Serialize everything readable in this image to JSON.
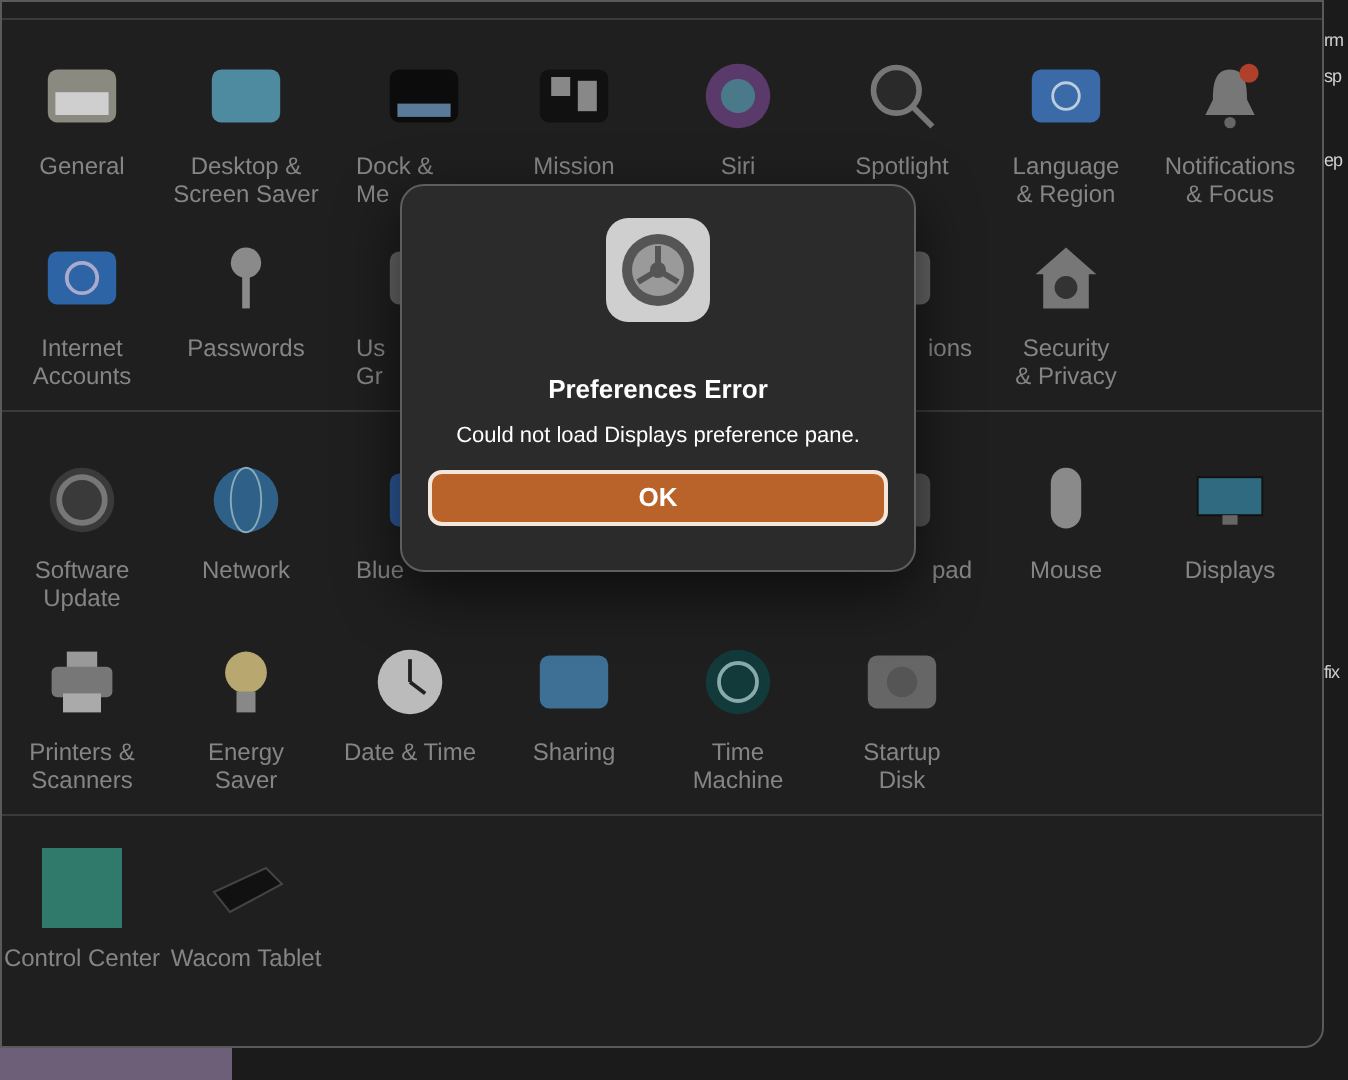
{
  "sections": [
    {
      "items": [
        {
          "label": "General"
        },
        {
          "label": "Desktop &\nScreen Saver"
        },
        {
          "label": "Dock &\nMe"
        },
        {
          "label": "Mission"
        },
        {
          "label": "Siri"
        },
        {
          "label": "Spotlight"
        },
        {
          "label": "Language\n& Region"
        },
        {
          "label": "Notifications\n& Focus"
        },
        {
          "label": "Internet\nAccounts"
        },
        {
          "label": "Passwords"
        },
        {
          "label": "Us\nGr"
        },
        {
          "label": "ions"
        },
        {
          "label": "Security\n& Privacy"
        }
      ]
    },
    {
      "items": [
        {
          "label": "Software\nUpdate"
        },
        {
          "label": "Network"
        },
        {
          "label": "Blue"
        },
        {
          "label": "pad"
        },
        {
          "label": "Mouse"
        },
        {
          "label": "Displays"
        },
        {
          "label": "Printers &\nScanners"
        },
        {
          "label": "Energy\nSaver"
        },
        {
          "label": "Date & Time"
        },
        {
          "label": "Sharing"
        },
        {
          "label": "Time\nMachine"
        },
        {
          "label": "Startup\nDisk"
        }
      ]
    },
    {
      "items": [
        {
          "label": "Control Center"
        },
        {
          "label": "Wacom Tablet"
        }
      ]
    }
  ],
  "dialog": {
    "title": "Preferences Error",
    "message": "Could not load Displays preference pane.",
    "button": "OK"
  },
  "background_fragments": [
    "rm",
    "sp",
    "ep",
    "fix"
  ]
}
